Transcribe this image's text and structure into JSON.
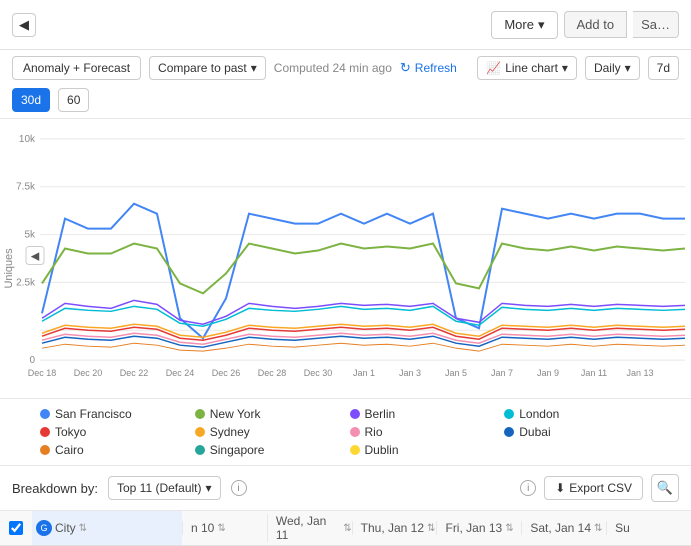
{
  "topbar": {
    "collapse_icon": "◀",
    "more_label": "More",
    "more_chevron": "▾",
    "add_to_label": "Add to",
    "save_label": "Sa…"
  },
  "toolbar": {
    "anomaly_forecast": "Anomaly + Forecast",
    "compare_to_past": "Compare to past",
    "compare_chevron": "▾",
    "computed_text": "Computed 24 min ago",
    "refresh_label": "Refresh",
    "line_chart": "Line chart",
    "line_chart_chevron": "▾",
    "daily": "Daily",
    "daily_chevron": "▾",
    "period_7d": "7d",
    "period_30d": "30d",
    "period_60": "60"
  },
  "chart": {
    "y_label": "Uniques",
    "y_ticks": [
      "10k",
      "7.5k",
      "5k",
      "2.5k",
      "0"
    ],
    "x_ticks": [
      "Dec 18",
      "Dec 20",
      "Dec 22",
      "Dec 24",
      "Dec 26",
      "Dec 28",
      "Dec 30",
      "Jan 1",
      "Jan 3",
      "Jan 5",
      "Jan 7",
      "Jan 9",
      "Jan 11",
      "Jan 13"
    ]
  },
  "legend": [
    {
      "label": "San Francisco",
      "color": "#4285f4"
    },
    {
      "label": "New York",
      "color": "#7cb342"
    },
    {
      "label": "Berlin",
      "color": "#7c4dff"
    },
    {
      "label": "London",
      "color": "#00bcd4"
    },
    {
      "label": "Tokyo",
      "color": "#e53935"
    },
    {
      "label": "Sydney",
      "color": "#f9a825"
    },
    {
      "label": "Rio",
      "color": "#f48fb1"
    },
    {
      "label": "Dubai",
      "color": "#1565c0"
    },
    {
      "label": "Cairo",
      "color": "#e67e22"
    },
    {
      "label": "Singapore",
      "color": "#26a69a"
    },
    {
      "label": "Dublin",
      "color": "#fdd835"
    }
  ],
  "breakdown": {
    "label": "Breakdown by:",
    "select_label": "Top 11 (Default)",
    "select_chevron": "▾",
    "export_label": "Export CSV",
    "info_text": "i"
  },
  "table": {
    "col_city": "City",
    "col_jan10": "n 10",
    "col_jan11": "Wed, Jan 11",
    "col_jan12": "Thu, Jan 12",
    "col_jan13": "Fri, Jan 13",
    "col_jan14": "Sat, Jan 14",
    "col_su": "Su",
    "sort_icon": "⇅",
    "city_icon_letter": "G",
    "city_name": "City",
    "checked": true
  },
  "colors": {
    "accent_blue": "#1a73e8",
    "active_tab": "#1a73e8",
    "row_highlight": "#e8f0fe"
  }
}
